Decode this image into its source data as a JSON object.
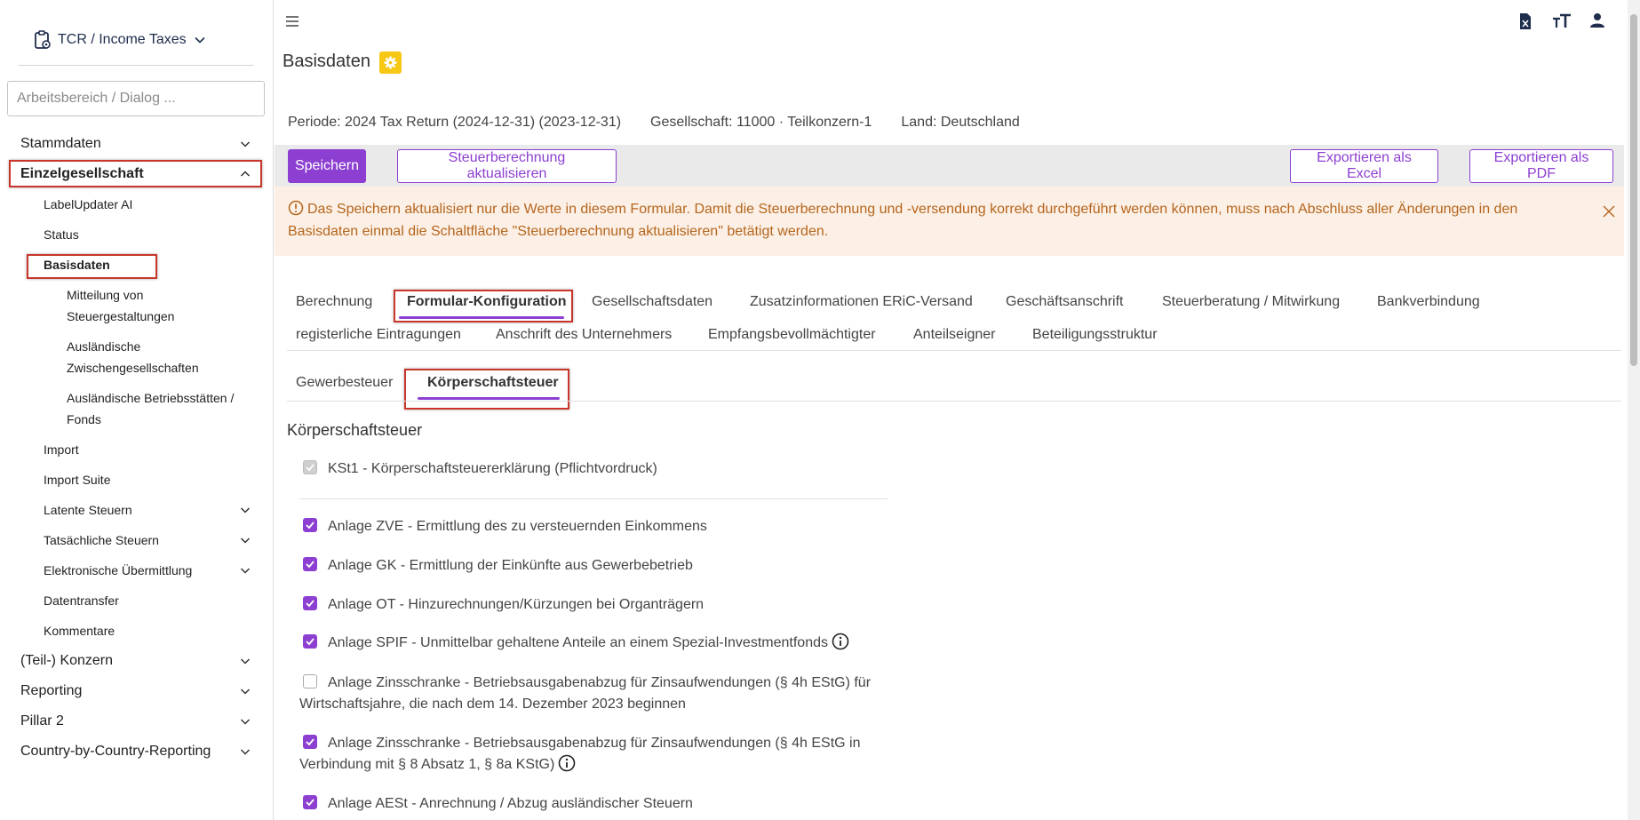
{
  "app": {
    "title": "TCR / Income Taxes",
    "search_placeholder": "Arbeitsbereich / Dialog ..."
  },
  "sidebar": {
    "stammdaten": "Stammdaten",
    "einzelgesellschaft": "Einzelgesellschaft",
    "labelupdater": "LabelUpdater AI",
    "status": "Status",
    "basisdaten": "Basisdaten",
    "mitteilung": "Mitteilung von Steuergestaltungen",
    "auslaendische_zwischen": "Ausländische Zwischengesellschaften",
    "auslaendische_betrieb": "Ausländische Betriebsstätten / Fonds",
    "import": "Import",
    "import_suite": "Import Suite",
    "latente": "Latente Steuern",
    "tatsaechliche": "Tatsächliche Steuern",
    "elektronische": "Elektronische Übermittlung",
    "datentransfer": "Datentransfer",
    "kommentare": "Kommentare",
    "konzern": "(Teil-) Konzern",
    "reporting": "Reporting",
    "pillar2": "Pillar 2",
    "cbcr": "Country-by-Country-Reporting"
  },
  "page": {
    "title": "Basisdaten",
    "periode": "Periode: 2024 Tax Return (2024-12-31) (2023-12-31)",
    "gesellschaft": "Gesellschaft: 11000 · Teilkonzern-1",
    "land": "Land: Deutschland"
  },
  "toolbar": {
    "save": "Speichern",
    "update": "Steuerberechnung aktualisieren",
    "excel": "Exportieren als Excel",
    "pdf": "Exportieren als PDF"
  },
  "alert": {
    "text": "Das Speichern aktualisiert nur die Werte in diesem Formular. Damit die Steuerberechnung und -versendung korrekt durchgeführt werden können, muss nach Abschluss aller Änderungen in den Basisdaten einmal die Schaltfläche \"Steuerberechnung aktualisieren\" betätigt werden."
  },
  "tabs": {
    "berechnung": "Berechnung",
    "formular": "Formular-Konfiguration",
    "gesellschaftsdaten": "Gesellschaftsdaten",
    "zusatz": "Zusatzinformationen ERiC-Versand",
    "geschaeftsanschrift": "Geschäftsanschrift",
    "steuerberatung": "Steuerberatung / Mitwirkung",
    "bank": "Bankverbindung",
    "register": "registerliche Eintragungen",
    "anschrift": "Anschrift des Unternehmers",
    "empfang": "Empfangsbevollmächtigter",
    "anteilseigner": "Anteilseigner",
    "beteiligung": "Beteiligungsstruktur"
  },
  "subtabs": {
    "gewerbe": "Gewerbesteuer",
    "koerperschaft": "Körperschaftsteuer"
  },
  "section": {
    "title": "Körperschaftsteuer",
    "kst1": "KSt1 - Körperschaftsteuererklärung (Pflichtvordruck)",
    "zve": "Anlage ZVE - Ermittlung des zu versteuernden Einkommens",
    "gk": "Anlage GK - Ermittlung der Einkünfte aus Gewerbebetrieb",
    "ot": "Anlage OT - Hinzurechnungen/Kürzungen bei Organträgern",
    "spif": "Anlage SPIF - Unmittelbar gehaltene Anteile an einem Spezial-Investmentfonds",
    "zins1": "Anlage Zinsschranke - Betriebsausgabenabzug für Zinsaufwendungen (§ 4h EStG) für Wirtschaftsjahre, die nach dem 14. Dezember 2023 beginnen",
    "zins2": "Anlage Zinsschranke - Betriebsausgabenabzug für Zinsaufwendungen (§ 4h EStG in Verbindung mit § 8 Absatz 1, § 8a KStG)",
    "aest": "Anlage AESt - Anrechnung / Abzug ausländischer Steuern"
  },
  "colors": {
    "accent": "#8c3fd1",
    "warning_bg": "#fcf0e6",
    "warning_text": "#b5651d",
    "highlight": "#c8352b",
    "badge": "#f6c713"
  }
}
